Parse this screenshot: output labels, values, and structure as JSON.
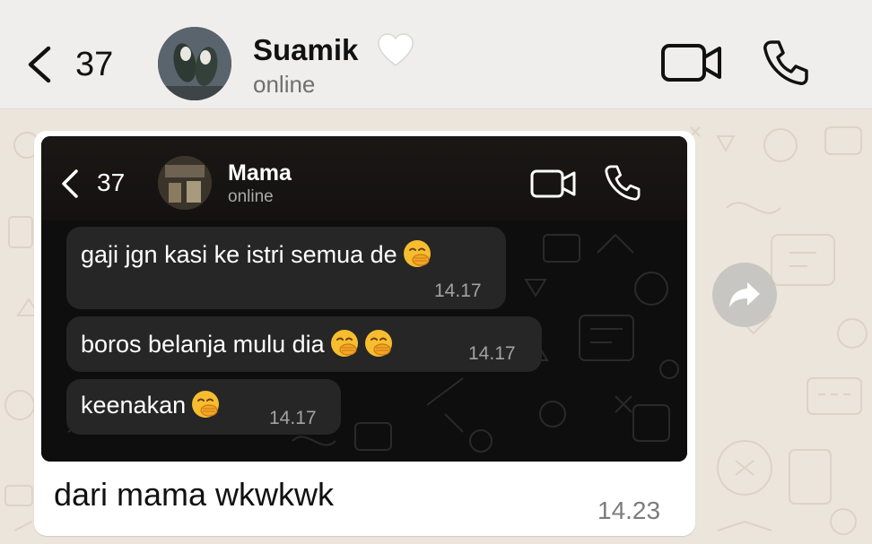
{
  "header": {
    "unread_count": "37",
    "contact_name": "Suamik",
    "status": "online"
  },
  "message": {
    "screenshot": {
      "header": {
        "unread_count": "37",
        "contact_name": "Mama",
        "status": "online"
      },
      "messages": [
        {
          "text": "gaji jgn kasi ke istri semua de",
          "time": "14.17",
          "emoji_count": 1
        },
        {
          "text": "boros belanja mulu dia",
          "time": "14.17",
          "emoji_count": 2
        },
        {
          "text": "keenakan",
          "time": "14.17",
          "emoji_count": 1
        }
      ],
      "emoji_name": "face-with-hand-over-mouth"
    },
    "caption": "dari mama wkwkwk",
    "time": "14.23"
  },
  "icons": {
    "back": "chevron-left-icon",
    "heart": "white-heart-icon",
    "video": "video-camera-icon",
    "call": "phone-icon",
    "forward": "forward-arrow-icon"
  },
  "colors": {
    "header_bg": "#efeeec",
    "chat_bg": "#ece5dc",
    "bubble_bg": "#ffffff",
    "dark_bg": "#0d0d0d",
    "dark_bubble": "#262626"
  }
}
